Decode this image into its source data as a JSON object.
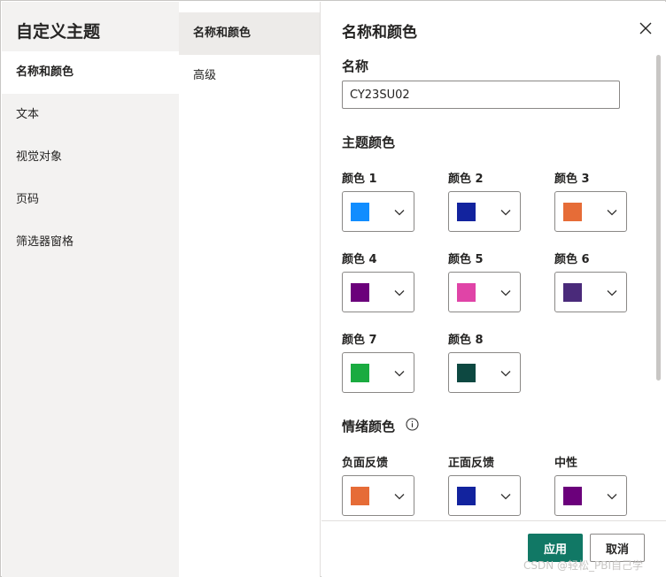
{
  "left_nav": {
    "title": "自定义主题",
    "items": [
      {
        "label": "名称和颜色",
        "active": true
      },
      {
        "label": "文本",
        "active": false
      },
      {
        "label": "视觉对象",
        "active": false
      },
      {
        "label": "页码",
        "active": false
      },
      {
        "label": "筛选器窗格",
        "active": false
      }
    ]
  },
  "sub_nav": {
    "items": [
      {
        "label": "名称和颜色",
        "active": true
      },
      {
        "label": "高级",
        "active": false
      }
    ]
  },
  "panel": {
    "title": "名称和颜色",
    "close_icon": "close-icon",
    "name_label": "名称",
    "name_value": "CY23SU02",
    "theme_colors_label": "主题颜色",
    "theme_colors": [
      {
        "label": "颜色 1",
        "color": "#118DFF"
      },
      {
        "label": "颜色 2",
        "color": "#12239E"
      },
      {
        "label": "颜色 3",
        "color": "#E66C37"
      },
      {
        "label": "颜色 4",
        "color": "#6B007B"
      },
      {
        "label": "颜色 5",
        "color": "#E044A7"
      },
      {
        "label": "颜色 6",
        "color": "#4A2A7A"
      },
      {
        "label": "颜色 7",
        "color": "#1AAB40"
      },
      {
        "label": "颜色 8",
        "color": "#0D4841"
      }
    ],
    "sentiment_label": "情绪颜色",
    "sentiment_icon": "info-icon",
    "sentiment_colors": [
      {
        "label": "负面反馈",
        "color": "#E66C37"
      },
      {
        "label": "正面反馈",
        "color": "#12239E"
      },
      {
        "label": "中性",
        "color": "#6B007B"
      }
    ]
  },
  "footer": {
    "apply_label": "应用",
    "cancel_label": "取消",
    "apply_color": "#117865"
  },
  "watermark": "CSDN @轻松_PBI自己学"
}
